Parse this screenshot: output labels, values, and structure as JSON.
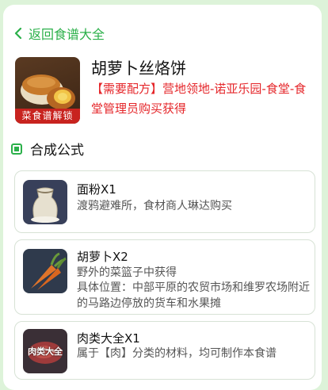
{
  "nav": {
    "back_label": "返回食谱大全"
  },
  "recipe": {
    "title": "胡萝卜丝烙饼",
    "badge": "菜食谱解锁",
    "description": "【需要配方】营地领地-诺亚乐园-食堂-食堂管理员购买获得"
  },
  "section": {
    "title": "合成公式"
  },
  "ingredients": [
    {
      "name": "面粉X1",
      "lines": [
        "渡鸦避难所，食材商人琳达购买"
      ],
      "icon": "flour-sack-icon"
    },
    {
      "name": "胡萝卜X2",
      "lines": [
        "野外的菜篮子中获得",
        "具体位置：中部平原的农贸市场和维罗农场附近的马路边停放的货车和水果摊"
      ],
      "icon": "carrot-icon"
    },
    {
      "name": "肉类大全X1",
      "lines": [
        "属于【肉】分类的材料，均可制作本食谱"
      ],
      "icon": "meat-icon",
      "thumb_label": "肉类大全"
    }
  ],
  "colors": {
    "accent": "#2bb04a",
    "highlight": "#e5262a",
    "background": "#ddf3d9"
  }
}
